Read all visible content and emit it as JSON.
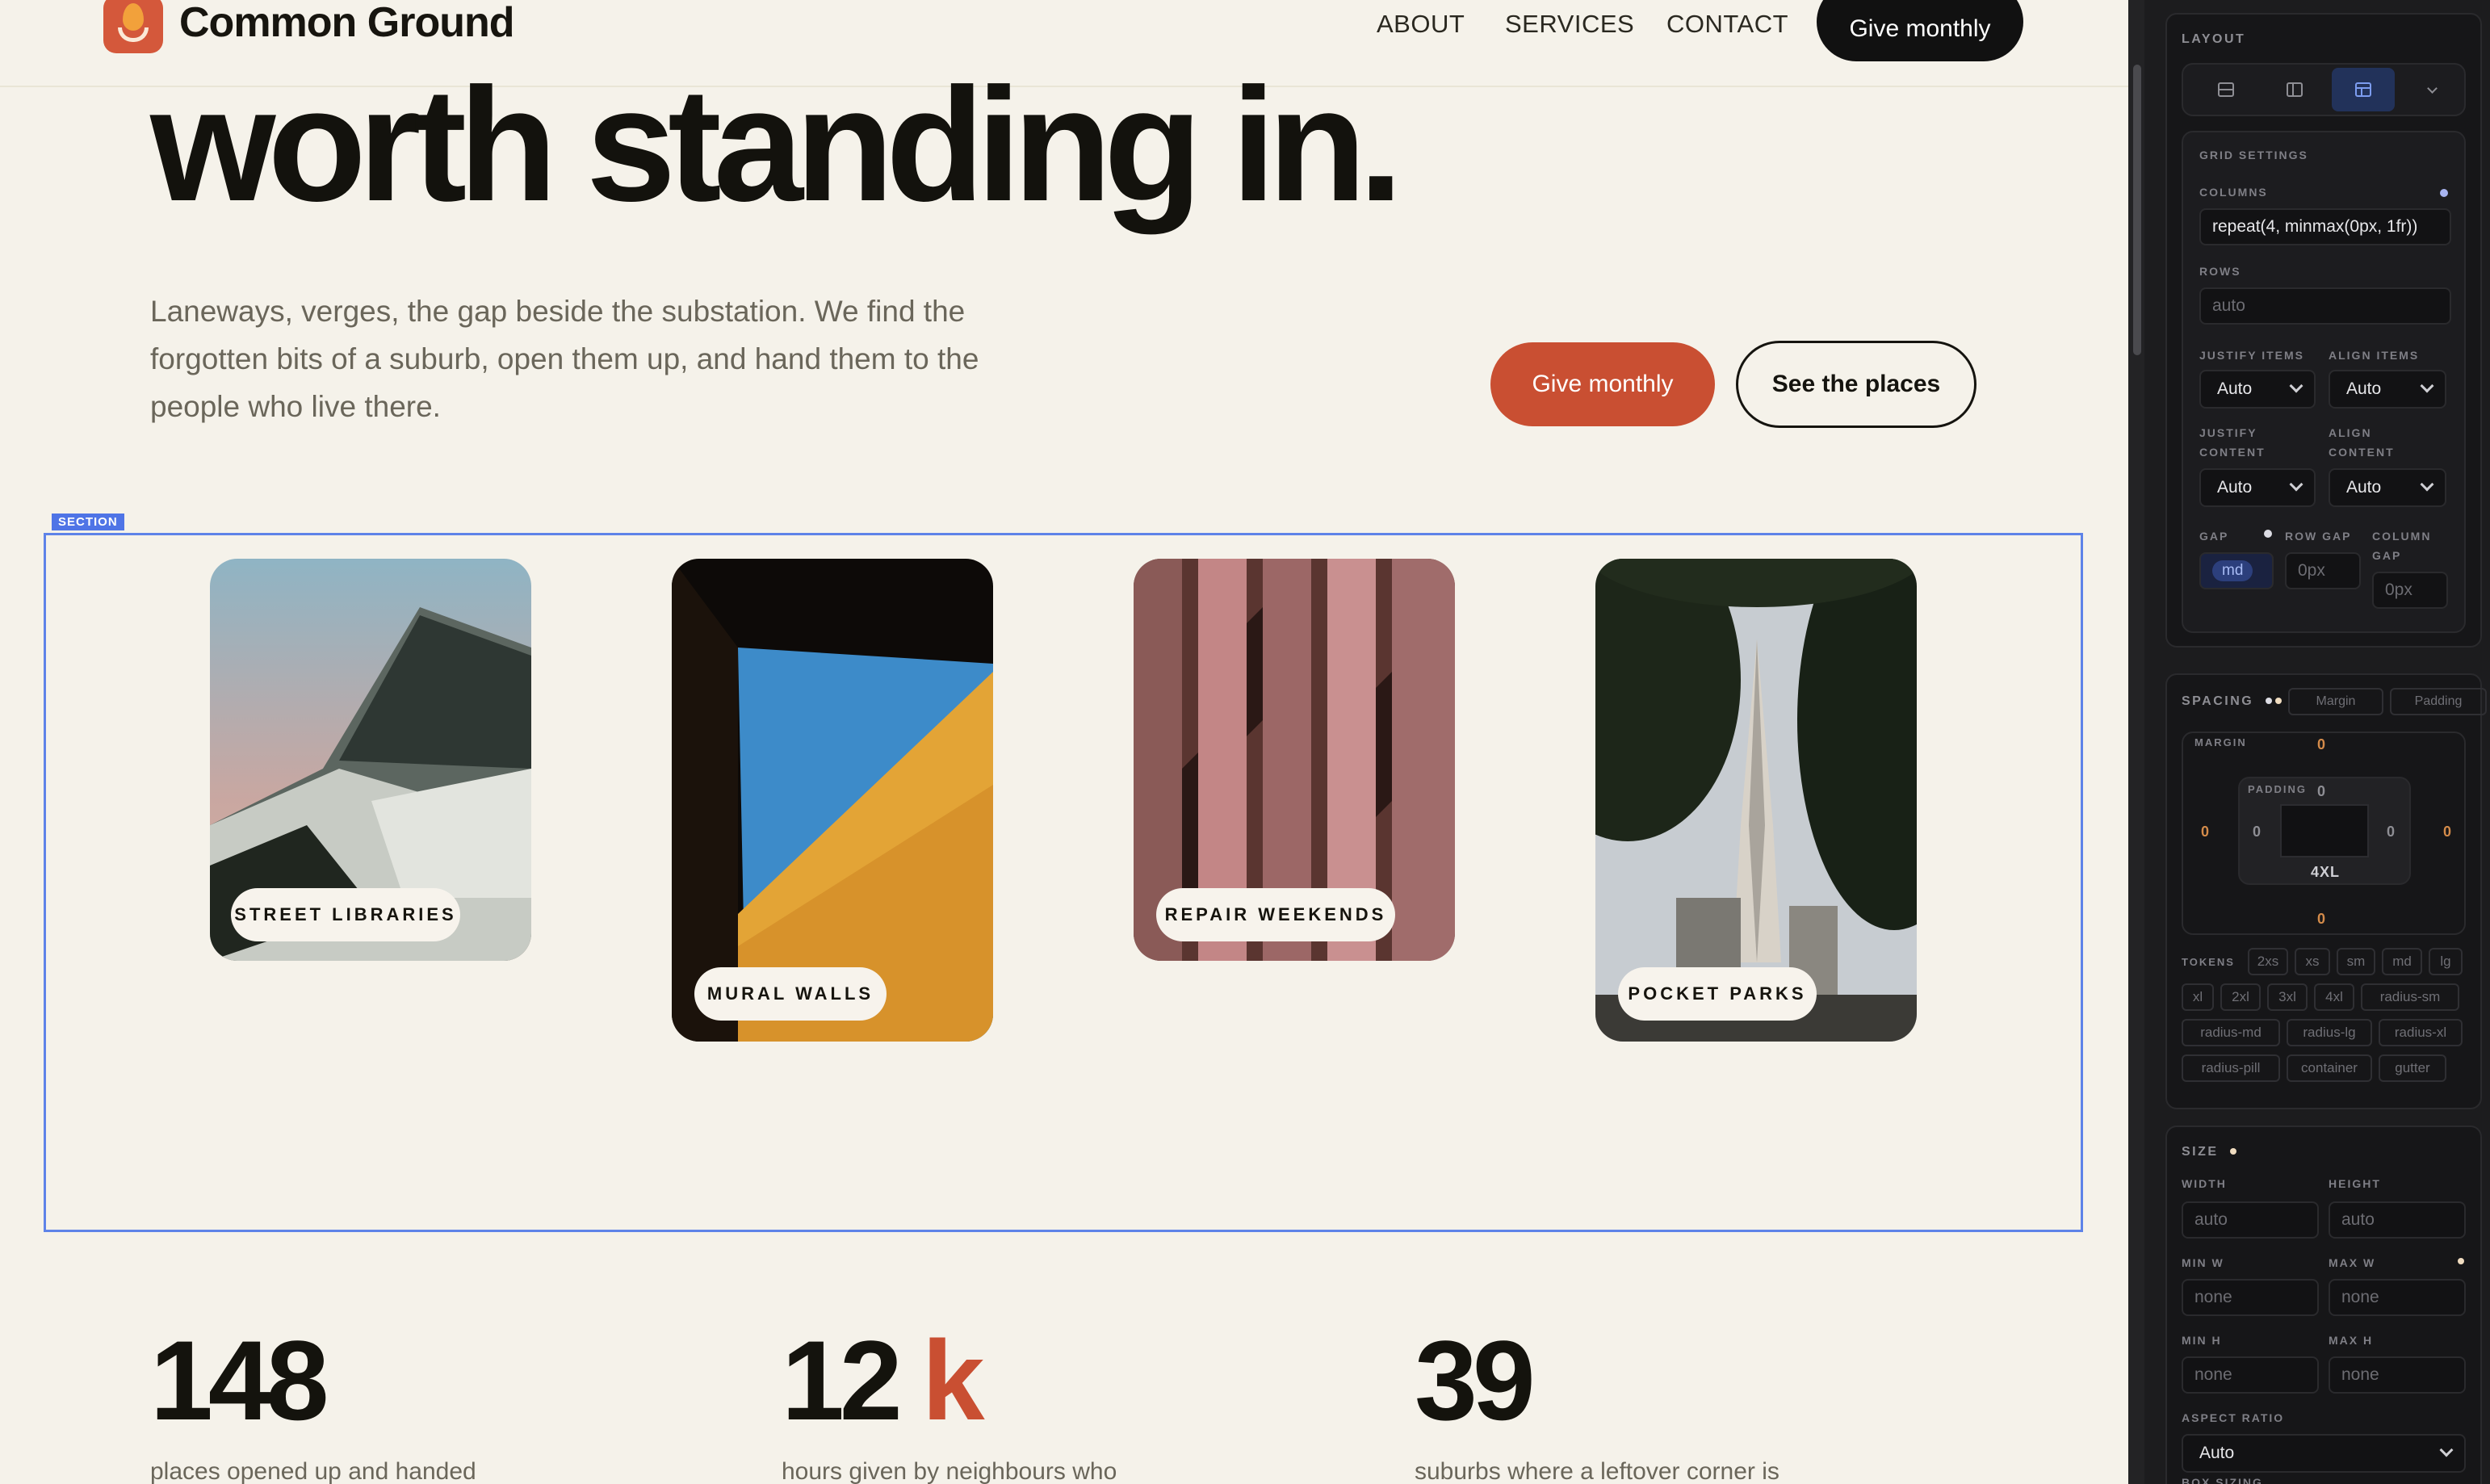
{
  "site": {
    "brand": "Common Ground",
    "nav": [
      "ABOUT",
      "SERVICES",
      "CONTACT"
    ],
    "nav_cta": "Give monthly",
    "hero_title": "worth standing in.",
    "hero_copy": "Laneways, verges, the gap beside the substation. We find the forgotten bits of a suburb, open them up, and hand them to the people who live there.",
    "btn_primary": "Give monthly",
    "btn_secondary": "See the places",
    "section_tag": "SECTION",
    "cards": [
      "STREET LIBRARIES",
      "MURAL WALLS",
      "REPAIR WEEKENDS",
      "POCKET PARKS"
    ],
    "stats": [
      {
        "num": "148",
        "accent": "",
        "desc": "places opened up and handed"
      },
      {
        "num": "12",
        "accent": "k",
        "desc": "hours given by neighbours who"
      },
      {
        "num": "39",
        "accent": "",
        "desc": "suburbs where a leftover corner is"
      }
    ],
    "colors": {
      "accent": "#c94f32",
      "background": "#f5f2ea",
      "selection": "#5e83e8"
    }
  },
  "panel": {
    "layout_label": "LAYOUT",
    "layout_modes": [
      "block-icon",
      "flex-icon",
      "grid-icon",
      "chevron-down-icon"
    ],
    "grid_settings_label": "GRID SETTINGS",
    "columns_label": "COLUMNS",
    "columns_value": "repeat(4, minmax(0px, 1fr))",
    "rows_label": "ROWS",
    "rows_placeholder": "auto",
    "justify_items_label": "JUSTIFY ITEMS",
    "justify_items_value": "Auto",
    "align_items_label": "ALIGN ITEMS",
    "align_items_value": "Auto",
    "justify_content_label": "JUSTIFY CONTENT",
    "justify_content_value": "Auto",
    "align_content_label": "ALIGN CONTENT",
    "align_content_value": "Auto",
    "gap_label": "GAP",
    "gap_value": "md",
    "row_gap_label": "ROW GAP",
    "row_gap_placeholder": "0px",
    "column_gap_label": "COLUMN GAP",
    "column_gap_placeholder": "0px",
    "spacing_label": "SPACING",
    "margin_toggle": "Margin",
    "padding_toggle": "Padding",
    "margin_label": "MARGIN",
    "padding_label": "PADDING",
    "margin_values": {
      "top": "0",
      "right": "0",
      "bottom": "0",
      "left": "0"
    },
    "padding_values": {
      "top": "0",
      "right": "0",
      "bottom": "4xl",
      "left": "0"
    },
    "tokens_label": "TOKENS",
    "tokens": [
      "2xs",
      "xs",
      "sm",
      "md",
      "lg",
      "xl",
      "2xl",
      "3xl",
      "4xl",
      "radius-sm",
      "radius-md",
      "radius-lg",
      "radius-xl",
      "radius-pill",
      "container",
      "gutter"
    ],
    "size_label": "SIZE",
    "width_label": "WIDTH",
    "width_placeholder": "auto",
    "height_label": "HEIGHT",
    "height_placeholder": "auto",
    "min_w_label": "MIN W",
    "min_w_placeholder": "none",
    "max_w_label": "MAX W",
    "max_w_placeholder": "none",
    "min_h_label": "MIN H",
    "min_h_placeholder": "none",
    "max_h_label": "MAX H",
    "max_h_placeholder": "none",
    "aspect_ratio_label": "ASPECT RATIO",
    "aspect_ratio_value": "Auto",
    "box_sizing_label": "BOX SIZING",
    "colors": {
      "panel_bg": "#1c1c1e",
      "accent_dot": "#a8b4f0",
      "warm_dot": "#f0dcc0",
      "token_value": "#d48b4a"
    }
  }
}
